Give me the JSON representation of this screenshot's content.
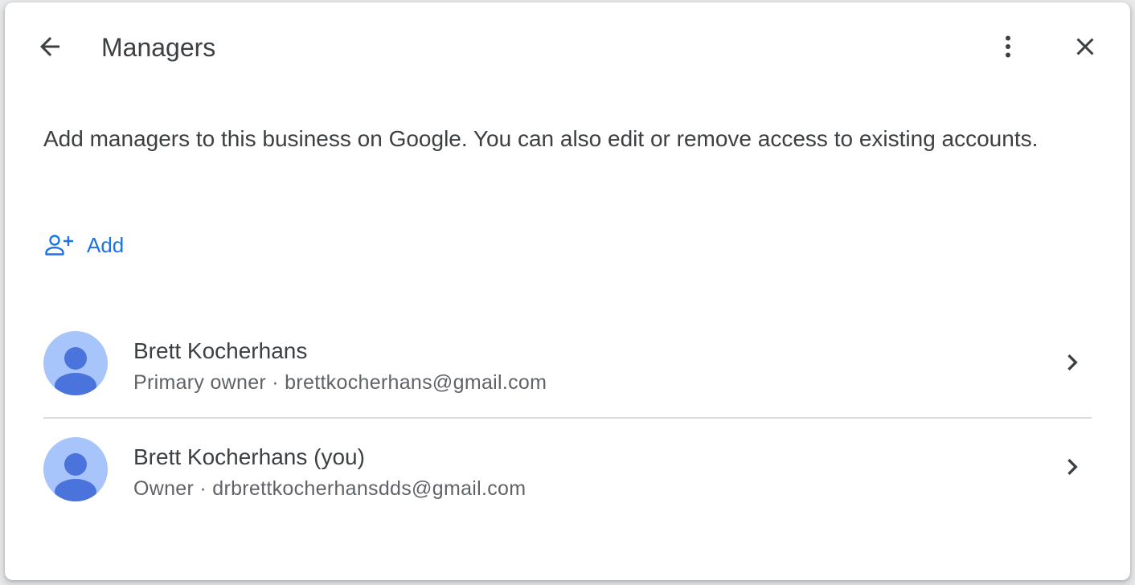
{
  "dialog": {
    "title": "Managers",
    "back_icon": "arrow-back-icon",
    "more_icon": "more-vert-icon",
    "close_icon": "close-icon"
  },
  "description": "Add managers to this business on Google. You can also edit or remove access to existing accounts.",
  "add_button": {
    "label": "Add",
    "icon": "person-add-icon"
  },
  "colors": {
    "accent": "#1a73e8",
    "text_primary": "#3c4043",
    "text_secondary": "#5f6368",
    "avatar_bg": "#a7c4fb",
    "avatar_fg": "#4a74dc",
    "divider": "#dadce0"
  },
  "managers": [
    {
      "name": "Brett Kocherhans",
      "role": "Primary owner",
      "email": "brettkocherhans@gmail.com",
      "subtitle": "Primary owner · brettkocherhans@gmail.com"
    },
    {
      "name": "Brett Kocherhans (you)",
      "role": "Owner",
      "email": "drbrettkocherhansdds@gmail.com",
      "subtitle": "Owner · drbrettkocherhansdds@gmail.com"
    }
  ]
}
